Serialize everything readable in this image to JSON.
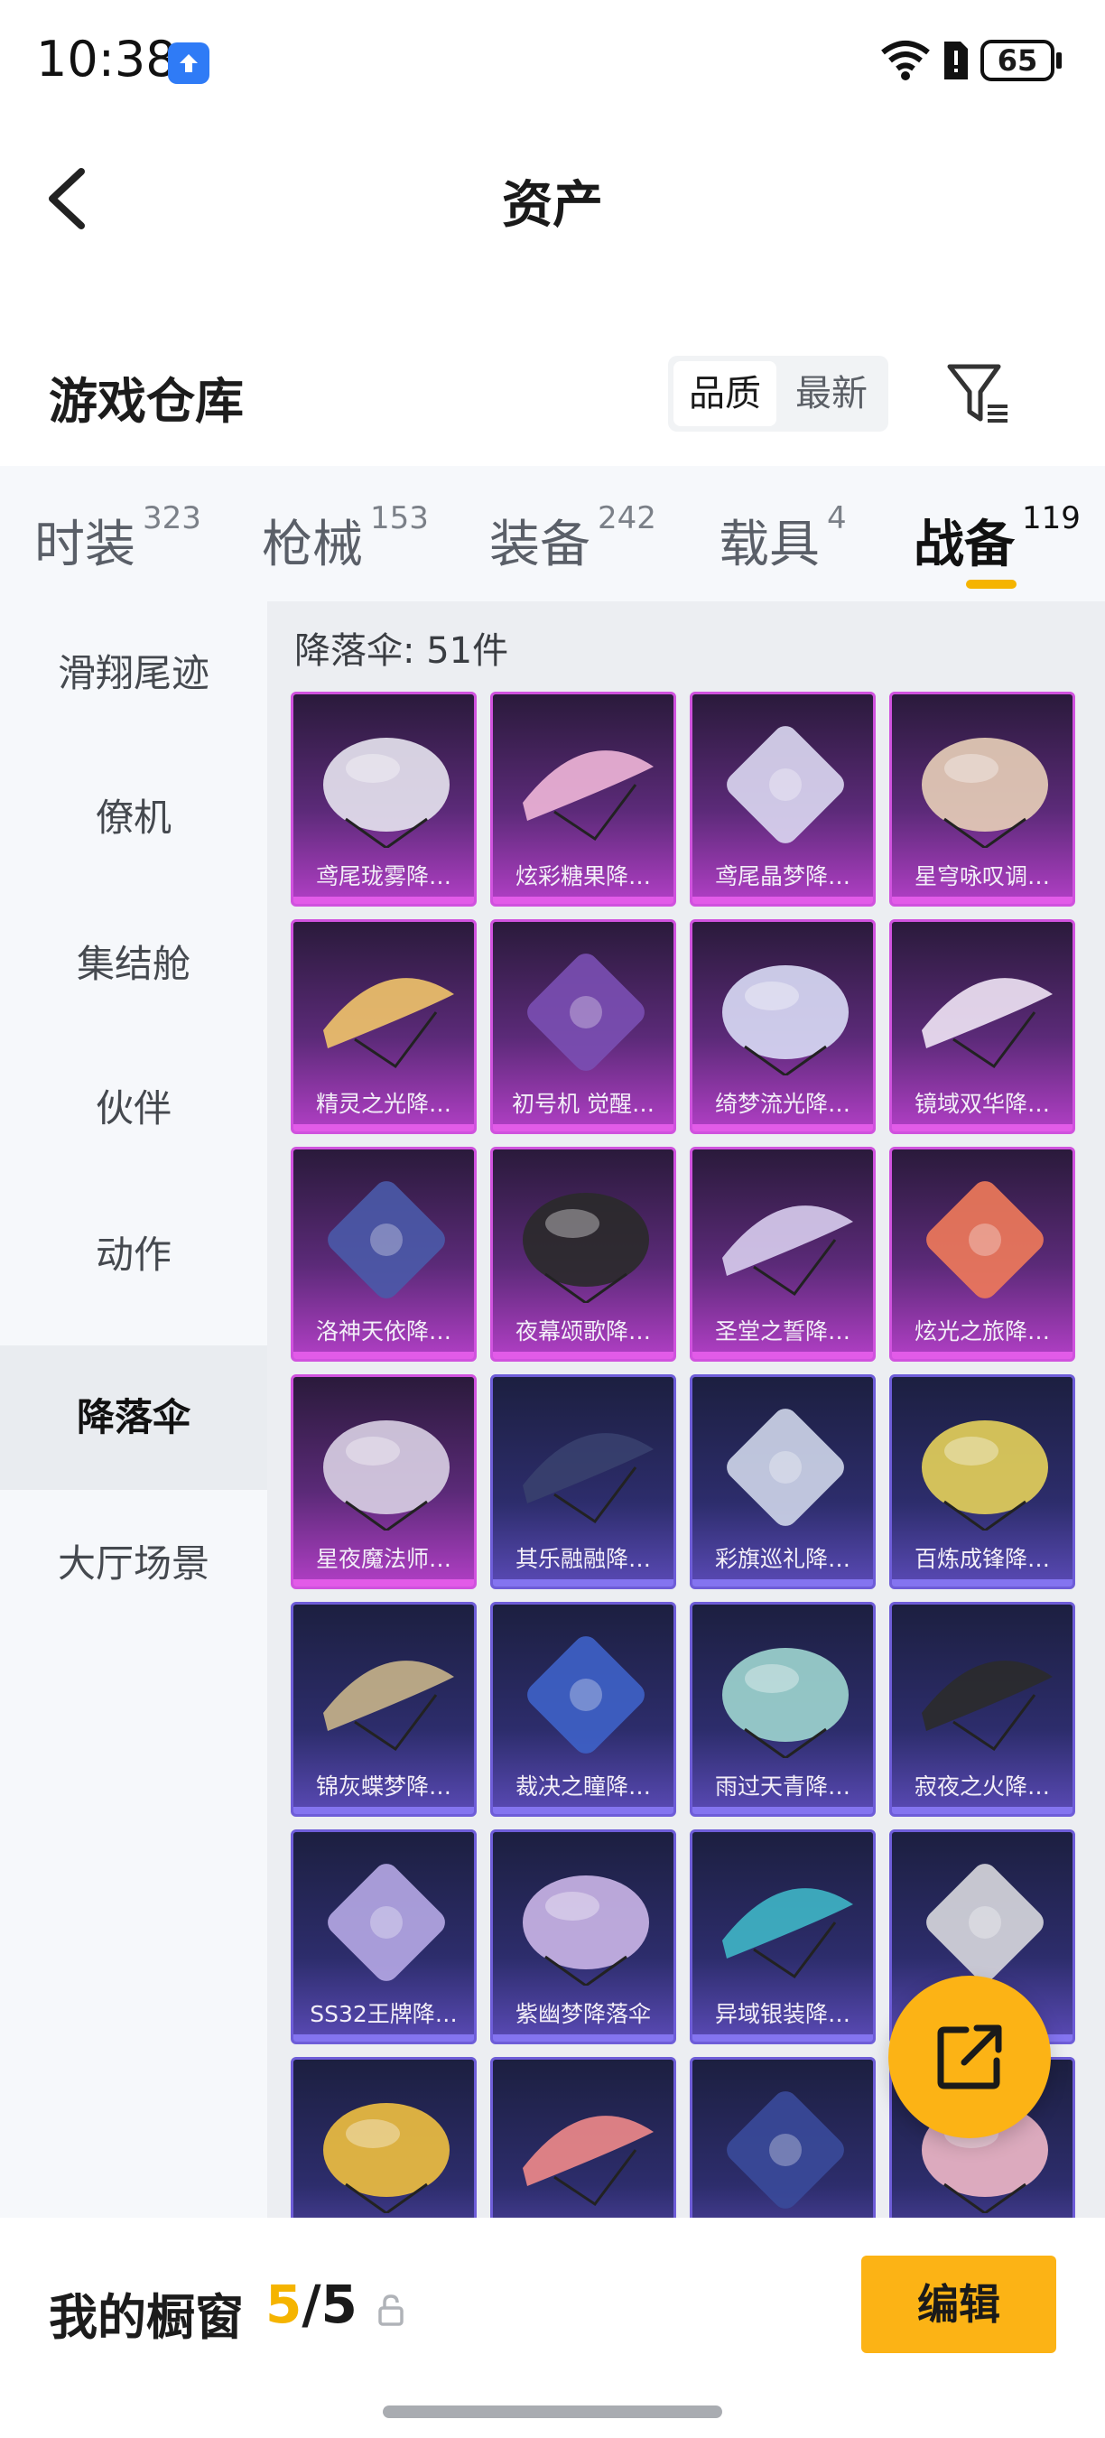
{
  "status_bar": {
    "time": "10:38",
    "battery": "65"
  },
  "header": {
    "title": "资产"
  },
  "warehouse": {
    "title": "游戏仓库",
    "sort_options": [
      "品质",
      "最新"
    ],
    "active_sort": "品质"
  },
  "categories": [
    {
      "label": "时装",
      "count": "323"
    },
    {
      "label": "枪械",
      "count": "153"
    },
    {
      "label": "装备",
      "count": "242"
    },
    {
      "label": "载具",
      "count": "4"
    },
    {
      "label": "战备",
      "count": "119"
    }
  ],
  "active_category": "战备",
  "sidebar": {
    "items": [
      "滑翔尾迹",
      "僚机",
      "集结舱",
      "伙伴",
      "动作",
      "降落伞",
      "大厅场景"
    ],
    "active": "降落伞"
  },
  "content": {
    "count_label": "降落伞: 51件"
  },
  "items": [
    {
      "name": "鸢尾珑雾降…",
      "rarity": "legend"
    },
    {
      "name": "炫彩糖果降…",
      "rarity": "legend"
    },
    {
      "name": "鸢尾晶梦降…",
      "rarity": "legend"
    },
    {
      "name": "星穹咏叹调…",
      "rarity": "legend"
    },
    {
      "name": "精灵之光降…",
      "rarity": "legend"
    },
    {
      "name": "初号机 觉醒…",
      "rarity": "legend"
    },
    {
      "name": "绮梦流光降…",
      "rarity": "legend"
    },
    {
      "name": "镜域双华降…",
      "rarity": "legend"
    },
    {
      "name": "洛神天依降…",
      "rarity": "legend"
    },
    {
      "name": "夜幕颂歌降…",
      "rarity": "legend"
    },
    {
      "name": "圣堂之誓降…",
      "rarity": "legend"
    },
    {
      "name": "炫光之旅降…",
      "rarity": "legend"
    },
    {
      "name": "星夜魔法师…",
      "rarity": "legend"
    },
    {
      "name": "其乐融融降…",
      "rarity": "epic"
    },
    {
      "name": "彩旗巡礼降…",
      "rarity": "epic"
    },
    {
      "name": "百炼成锋降…",
      "rarity": "epic"
    },
    {
      "name": "锦灰蝶梦降…",
      "rarity": "epic"
    },
    {
      "name": "裁决之瞳降…",
      "rarity": "epic"
    },
    {
      "name": "雨过天青降…",
      "rarity": "epic"
    },
    {
      "name": "寂夜之火降…",
      "rarity": "epic"
    },
    {
      "name": "SS32王牌降…",
      "rarity": "epic"
    },
    {
      "name": "紫幽梦降落伞",
      "rarity": "epic"
    },
    {
      "name": "异域银装降…",
      "rarity": "epic"
    },
    {
      "name": "",
      "rarity": "epic"
    },
    {
      "name": "",
      "rarity": "epic"
    },
    {
      "name": "",
      "rarity": "epic"
    },
    {
      "name": "",
      "rarity": "epic"
    },
    {
      "name": "",
      "rarity": "epic"
    }
  ],
  "colors": {
    "accent": "#fcb315",
    "legend_border": "#d052de",
    "epic_border": "#6e5dd8"
  },
  "showcase": {
    "label": "我的橱窗",
    "current": "5",
    "total": "/5",
    "edit_label": "编辑"
  }
}
